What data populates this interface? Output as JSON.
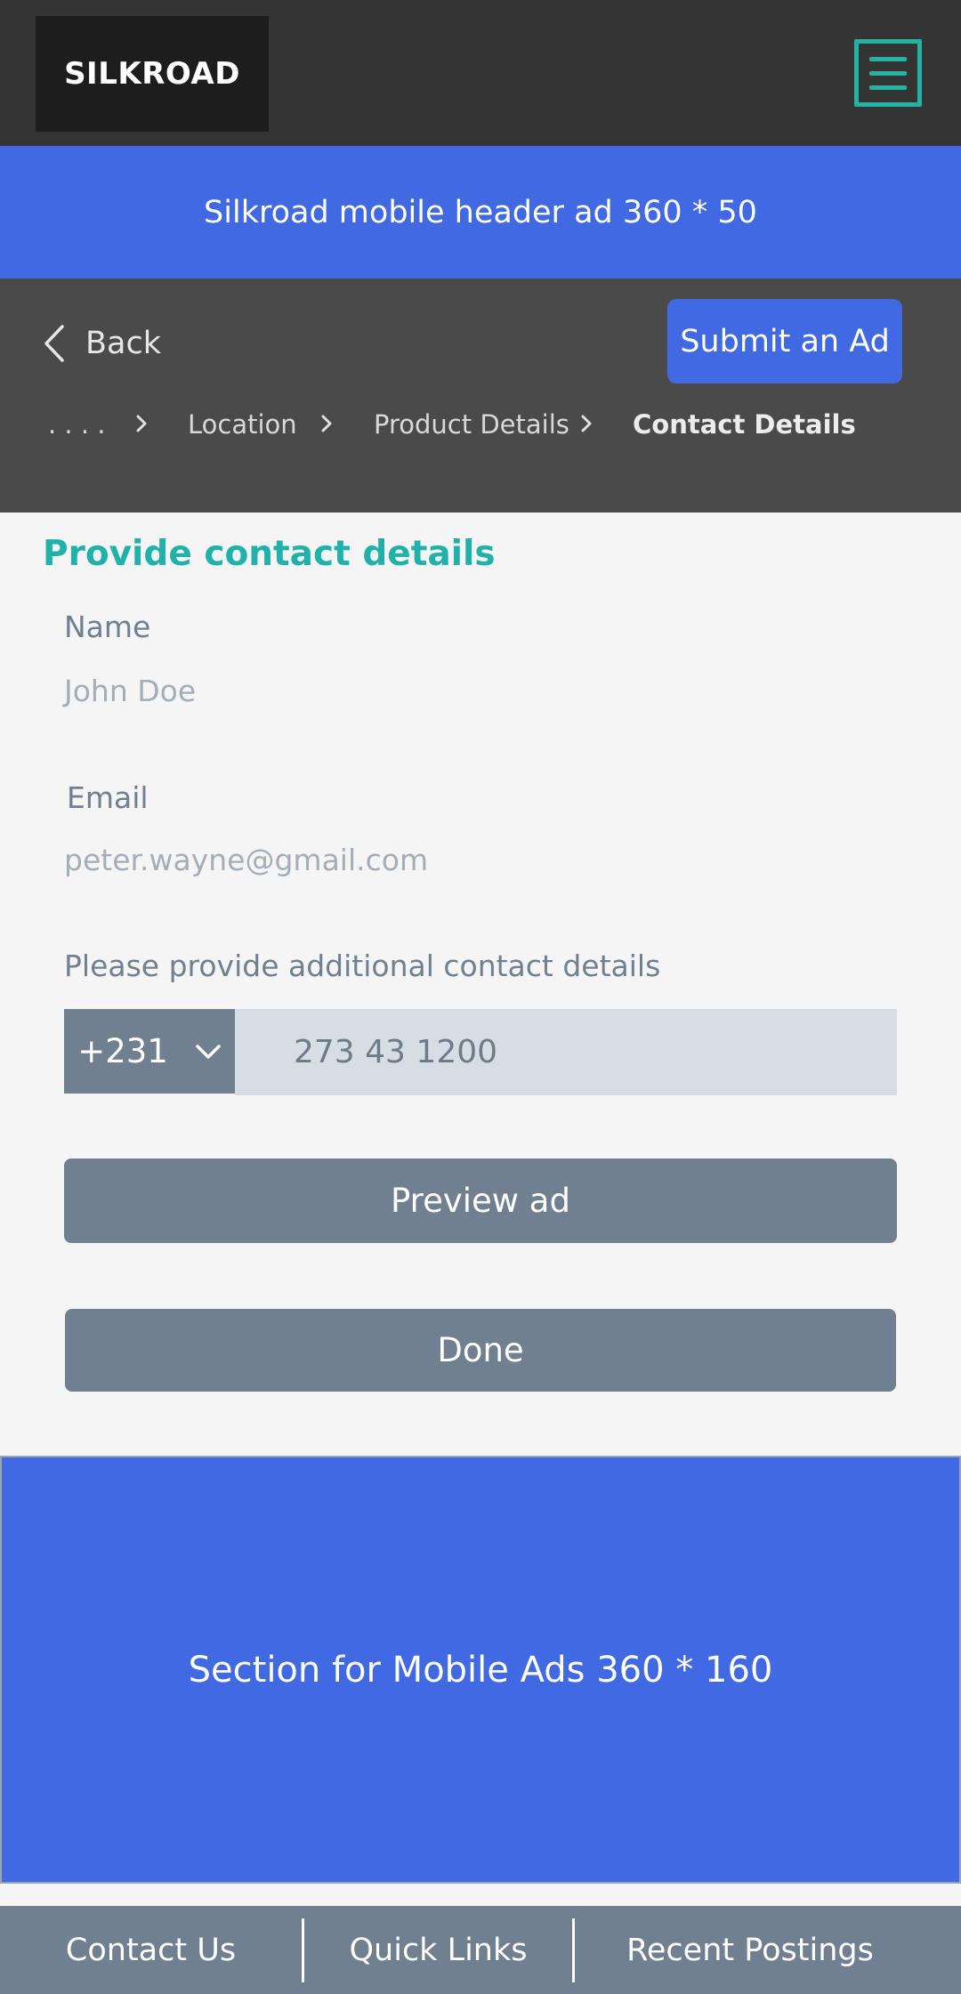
{
  "brand": {
    "logo_text": "SILKROAD"
  },
  "header": {
    "menu_icon": "hamburger-menu-icon",
    "accent_color": "#20b2aa"
  },
  "header_ad": {
    "text": "Silkroad mobile header ad 360 * 50"
  },
  "nav": {
    "back_label": "Back",
    "back_icon": "chevron-left-icon",
    "submit_label": "Submit an Ad",
    "breadcrumb": {
      "ellipsis": ". . . .",
      "items": [
        "Location",
        "Product Details",
        "Contact Details"
      ],
      "separator_icon": "chevron-right-icon"
    }
  },
  "form": {
    "title": "Provide contact details",
    "name_label": "Name",
    "name_value": "John Doe",
    "email_label": "Email",
    "email_value": "peter.wayne@gmail.com",
    "additional_label": "Please provide additional contact details",
    "country_code": "+231",
    "country_code_icon": "chevron-down-icon",
    "phone_placeholder": "273 43 1200",
    "preview_label": "Preview ad",
    "done_label": "Done"
  },
  "bottom_ad": {
    "text": "Section for Mobile Ads 360 * 160"
  },
  "footer": {
    "links": [
      "Contact Us",
      "Quick Links",
      "Recent Postings"
    ]
  },
  "colors": {
    "primary_blue": "#4169e1",
    "slate": "#708090",
    "teal": "#20b2aa",
    "top_bar": "#343434",
    "nav_bar": "#4a4a4a"
  }
}
